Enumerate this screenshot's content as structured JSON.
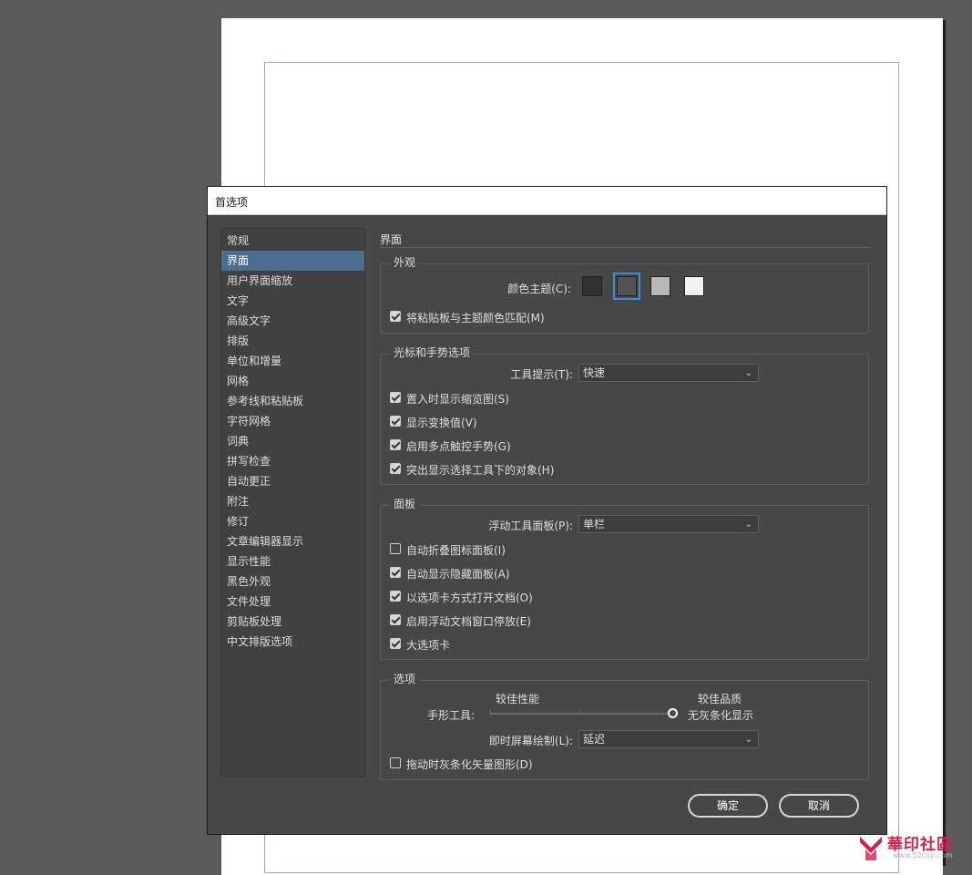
{
  "dialog": {
    "title": "首选项"
  },
  "sidebar": {
    "items": [
      {
        "label": "常规"
      },
      {
        "label": "界面",
        "active": true
      },
      {
        "label": "用户界面缩放"
      },
      {
        "label": "文字"
      },
      {
        "label": "高级文字"
      },
      {
        "label": "排版"
      },
      {
        "label": "单位和增量"
      },
      {
        "label": "网格"
      },
      {
        "label": "参考线和粘贴板"
      },
      {
        "label": "字符网格"
      },
      {
        "label": "词典"
      },
      {
        "label": "拼写检查"
      },
      {
        "label": "自动更正"
      },
      {
        "label": "附注"
      },
      {
        "label": "修订"
      },
      {
        "label": "文章编辑器显示"
      },
      {
        "label": "显示性能"
      },
      {
        "label": "黑色外观"
      },
      {
        "label": "文件处理"
      },
      {
        "label": "剪贴板处理"
      },
      {
        "label": "中文排版选项"
      }
    ]
  },
  "main": {
    "section_title": "界面",
    "appearance": {
      "group_label": "外观",
      "color_theme_label": "颜色主题(C):",
      "themes": [
        {
          "color": "#323232",
          "selected": false
        },
        {
          "color": "#535353",
          "selected": true
        },
        {
          "color": "#b8b8b8",
          "selected": false
        },
        {
          "color": "#f0f0f0",
          "selected": false
        }
      ],
      "match_pasteboard": {
        "label": "将粘贴板与主题颜色匹配(M)",
        "checked": true
      }
    },
    "cursor": {
      "group_label": "光标和手势选项",
      "tooltip_label": "工具提示(T):",
      "tooltip_value": "快速",
      "options": [
        {
          "label": "置入时显示缩览图(S)",
          "checked": true
        },
        {
          "label": "显示变换值(V)",
          "checked": true
        },
        {
          "label": "启用多点触控手势(G)",
          "checked": true
        },
        {
          "label": "突出显示选择工具下的对象(H)",
          "checked": true
        }
      ]
    },
    "panels": {
      "group_label": "面板",
      "floating_label": "浮动工具面板(P):",
      "floating_value": "单栏",
      "options": [
        {
          "label": "自动折叠图标面板(I)",
          "checked": false
        },
        {
          "label": "自动显示隐藏面板(A)",
          "checked": true
        },
        {
          "label": "以选项卡方式打开文档(O)",
          "checked": true
        },
        {
          "label": "启用浮动文档窗口停放(E)",
          "checked": true
        },
        {
          "label": "大选项卡",
          "checked": true
        }
      ]
    },
    "options": {
      "group_label": "选项",
      "slider_left": "较佳性能",
      "slider_right": "较佳品质",
      "hand_tool_label": "手形工具:",
      "hand_tool_value_label": "无灰条化显示",
      "live_draw_label": "即时屏幕绘制(L):",
      "live_draw_value": "延迟",
      "greek_vector": {
        "label": "拖动时灰条化矢量图形(D)",
        "checked": false
      }
    }
  },
  "buttons": {
    "ok": "确定",
    "cancel": "取消"
  },
  "watermark": {
    "text": "華印社區",
    "url": "www.52cnp.com"
  }
}
